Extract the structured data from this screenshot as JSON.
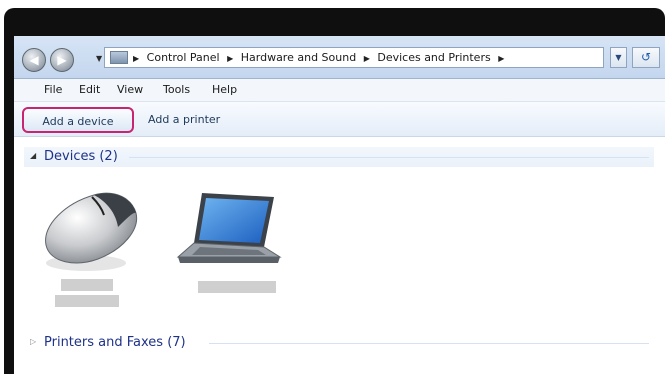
{
  "window": {
    "address": {
      "crumbs": [
        "Control Panel",
        "Hardware and Sound",
        "Devices and Printers"
      ],
      "separator": "▶"
    },
    "menu": [
      "File",
      "Edit",
      "View",
      "Tools",
      "Help"
    ],
    "toolbar": {
      "add_device": "Add a device",
      "add_printer": "Add a printer",
      "highlight_color": "#c72572"
    },
    "groups": {
      "devices": "Devices (2)",
      "printers": "Printers and Faxes (7)"
    },
    "devices": [
      {
        "icon": "mouse-icon"
      },
      {
        "icon": "laptop-icon"
      }
    ]
  }
}
